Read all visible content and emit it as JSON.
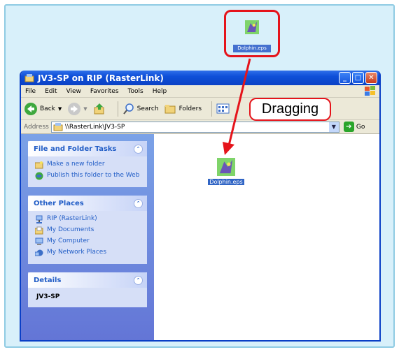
{
  "desktop": {
    "icon_label": "Dolphin.eps"
  },
  "window": {
    "title": "JV3-SP on RIP (RasterLink)",
    "menu": [
      "File",
      "Edit",
      "View",
      "Favorites",
      "Tools",
      "Help"
    ],
    "toolbar": {
      "back": "Back",
      "search": "Search",
      "folders": "Folders"
    },
    "address": {
      "label": "Address",
      "value": "\\\\RasterLink\\JV3-SP",
      "go": "Go"
    },
    "panels": {
      "tasks": {
        "title": "File and Folder Tasks",
        "items": [
          "Make a new folder",
          "Publish this folder to the Web"
        ]
      },
      "places": {
        "title": "Other Places",
        "items": [
          "RIP (RasterLink)",
          "My Documents",
          "My Computer",
          "My Network Places"
        ]
      },
      "details": {
        "title": "Details",
        "value": "JV3-SP"
      }
    },
    "file": {
      "label": "Dolphin.eps"
    }
  },
  "callout": {
    "text": "Dragging"
  },
  "colors": {
    "accent_red": "#e5141b",
    "xp_blue": "#0b42c5",
    "taskpane": "#6375d6"
  }
}
